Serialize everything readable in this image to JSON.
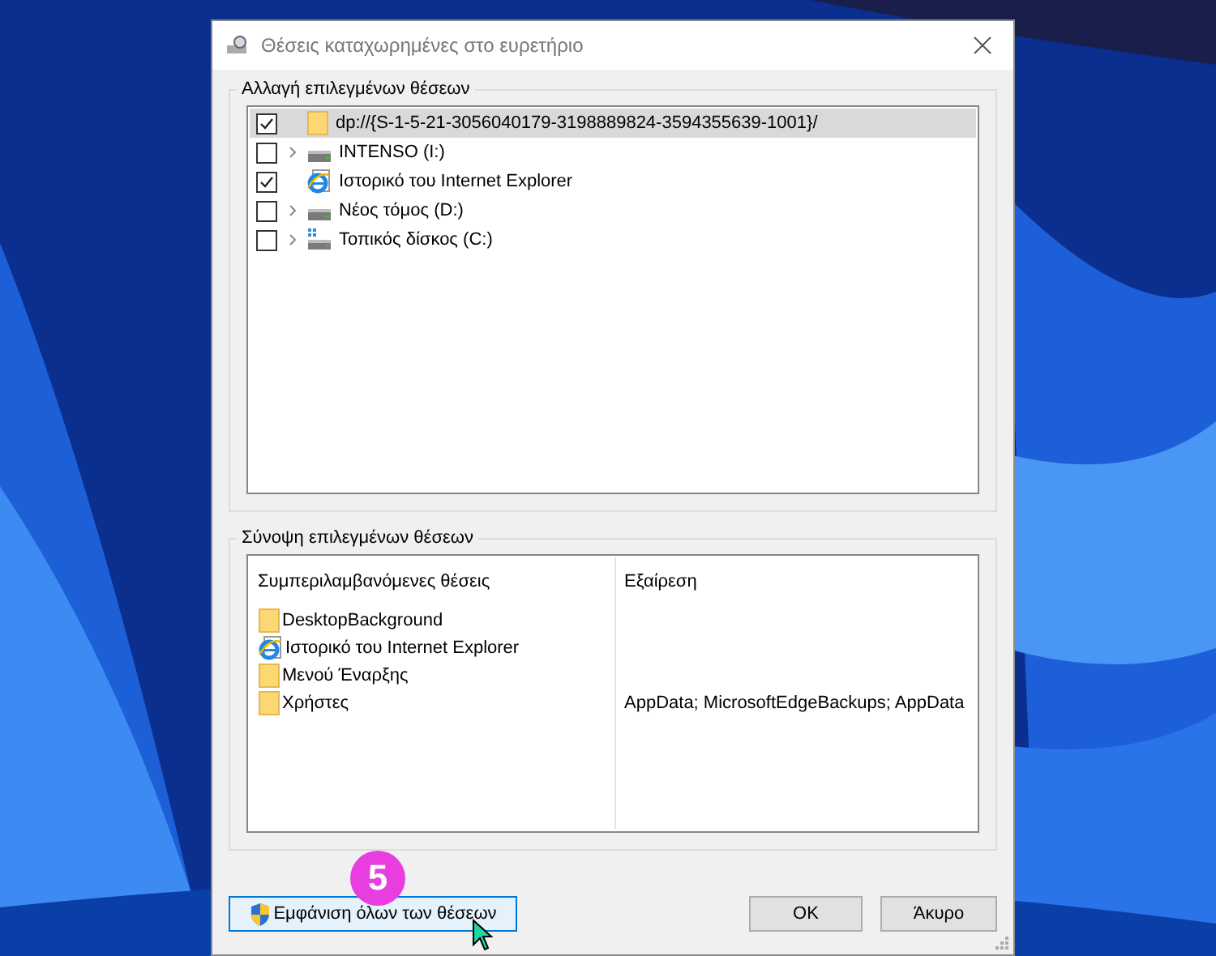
{
  "window": {
    "title": "Θέσεις καταχωρημένες στο ευρετήριο"
  },
  "change_group": {
    "title": "Αλλαγή επιλεγμένων θέσεων",
    "items": [
      {
        "label": "dp://{S-1-5-21-3056040179-3198889824-3594355639-1001}/",
        "checked": true,
        "expandable": false,
        "selected": true,
        "kind": "folder"
      },
      {
        "label": "INTENSO (I:)",
        "checked": false,
        "expandable": true,
        "selected": false,
        "kind": "drive"
      },
      {
        "label": "Ιστορικό του Internet Explorer",
        "checked": true,
        "expandable": false,
        "selected": false,
        "kind": "ie"
      },
      {
        "label": "Νέος τόμος (D:)",
        "checked": false,
        "expandable": true,
        "selected": false,
        "kind": "drive"
      },
      {
        "label": "Τοπικός δίσκος (C:)",
        "checked": false,
        "expandable": true,
        "selected": false,
        "kind": "system-drive"
      }
    ]
  },
  "summary_group": {
    "title": "Σύνοψη επιλεγμένων θέσεων",
    "columns": [
      "Συμπεριλαμβανόμενες θέσεις",
      "Εξαίρεση"
    ],
    "rows": [
      {
        "location": "DesktopBackground",
        "kind": "folder"
      },
      {
        "location": "Ιστορικό του Internet Explorer",
        "kind": "ie"
      },
      {
        "location": "Μενού Έναρξης",
        "kind": "folder"
      },
      {
        "location": "Χρήστες",
        "kind": "folder",
        "exclusion": "AppData; MicrosoftEdgeBackups; AppData"
      }
    ]
  },
  "buttons": {
    "show_all": "Εμφάνιση όλων των θέσεων",
    "ok": "OK",
    "cancel": "Άκυρο"
  },
  "step_badge": "5"
}
